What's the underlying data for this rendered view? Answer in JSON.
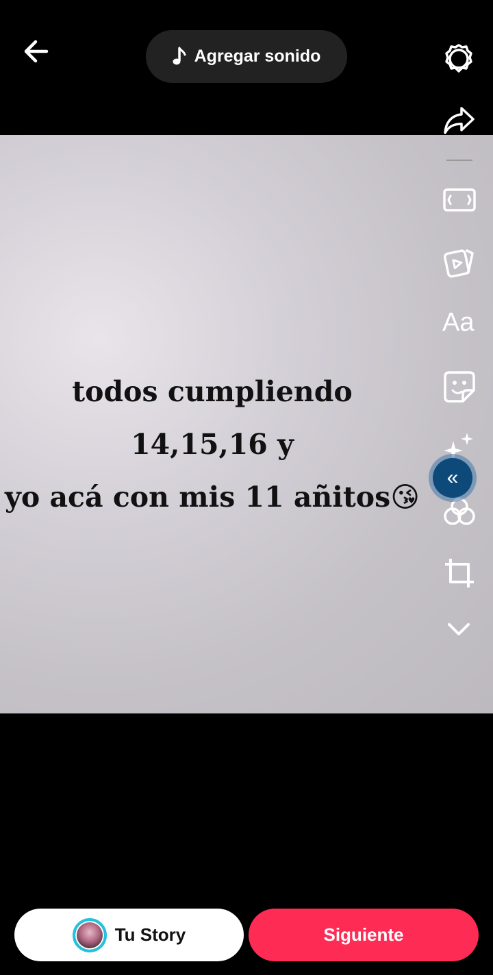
{
  "header": {
    "back_icon": "arrow-left-icon",
    "sound_button": {
      "icon": "music-note-icon",
      "label": "Agregar sonido"
    }
  },
  "photo": {
    "caption_line1": "todos cumpliendo 14,15,16 y",
    "caption_line2": "yo acá con mis 11 añitos",
    "caption_emoji": "😘"
  },
  "sidebar": {
    "items": [
      {
        "name": "settings-icon"
      },
      {
        "name": "share-arrow-icon"
      },
      {
        "name": "aspect-ratio-icon"
      },
      {
        "name": "templates-icon"
      },
      {
        "name": "text-icon",
        "label": "Aa"
      },
      {
        "name": "sticker-icon"
      },
      {
        "name": "effects-sparkle-icon"
      },
      {
        "name": "filters-icon"
      },
      {
        "name": "crop-icon"
      },
      {
        "name": "chevron-down-icon"
      }
    ],
    "collapse_glyph": "«"
  },
  "footer": {
    "story_label": "Tu Story",
    "next_label": "Siguiente"
  },
  "colors": {
    "primary": "#fe2c55",
    "story_ring": "#1fc4dc",
    "collapse_button": "#0d4a7a"
  }
}
